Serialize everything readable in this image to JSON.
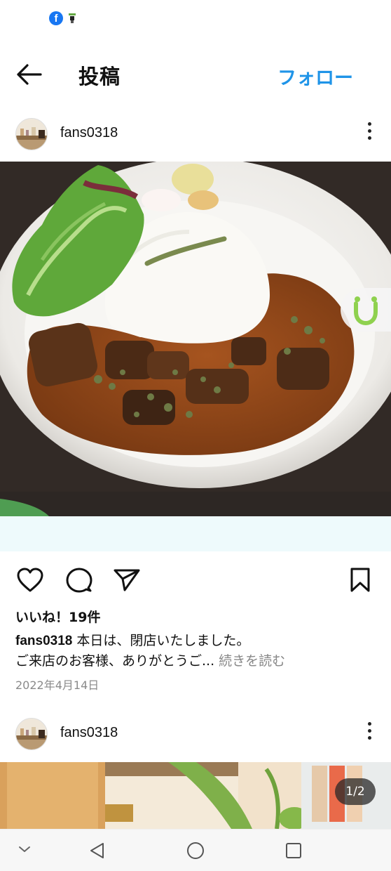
{
  "status_bar": {
    "icons": [
      "facebook-icon",
      "app-notification-icon"
    ],
    "facebook_glyph": "f"
  },
  "header": {
    "title": "投稿",
    "follow_label": "フォロー",
    "back_icon": "arrow-left-icon"
  },
  "posts": [
    {
      "username": "fans0318",
      "likes_text": "いいね！19件",
      "caption_line1": "本日は、閉店いたしました。",
      "caption_line2": "ご来店のお客様、ありがとうご...",
      "more_label": "続きを読む",
      "date": "2022年4月14日"
    },
    {
      "username": "fans0318",
      "page_indicator": "1/2"
    }
  ],
  "colors": {
    "accent": "#1f94e8",
    "muted": "#8a8a8a",
    "strip": "#eefafc"
  },
  "nav_bar": {
    "icons": [
      "chevron-down-icon",
      "back-triangle-icon",
      "home-circle-icon",
      "recents-square-icon"
    ]
  }
}
